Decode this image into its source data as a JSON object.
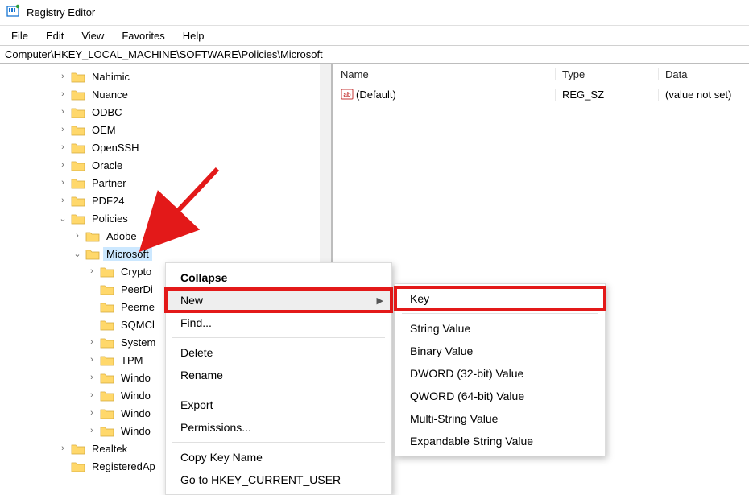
{
  "window": {
    "title": "Registry Editor"
  },
  "menu": {
    "items": [
      "File",
      "Edit",
      "View",
      "Favorites",
      "Help"
    ]
  },
  "address": {
    "path": "Computer\\HKEY_LOCAL_MACHINE\\SOFTWARE\\Policies\\Microsoft"
  },
  "tree": {
    "baseIndent": 72,
    "nodes": [
      {
        "label": "Nahimic",
        "chevron": ">",
        "indent": 72
      },
      {
        "label": "Nuance",
        "chevron": ">",
        "indent": 72
      },
      {
        "label": "ODBC",
        "chevron": ">",
        "indent": 72
      },
      {
        "label": "OEM",
        "chevron": ">",
        "indent": 72
      },
      {
        "label": "OpenSSH",
        "chevron": ">",
        "indent": 72
      },
      {
        "label": "Oracle",
        "chevron": ">",
        "indent": 72
      },
      {
        "label": "Partner",
        "chevron": ">",
        "indent": 72
      },
      {
        "label": "PDF24",
        "chevron": ">",
        "indent": 72
      },
      {
        "label": "Policies",
        "chevron": "v",
        "indent": 72
      },
      {
        "label": "Adobe",
        "chevron": ">",
        "indent": 90
      },
      {
        "label": "Microsoft",
        "chevron": "v",
        "indent": 90,
        "selected": true
      },
      {
        "label": "Crypto",
        "chevron": ">",
        "indent": 108,
        "clip": "Crypto"
      },
      {
        "label": "PeerDi",
        "chevron": "",
        "indent": 108
      },
      {
        "label": "Peerne",
        "chevron": "",
        "indent": 108
      },
      {
        "label": "SQMCl",
        "chevron": "",
        "indent": 108
      },
      {
        "label": "System",
        "chevron": ">",
        "indent": 108
      },
      {
        "label": "TPM",
        "chevron": ">",
        "indent": 108
      },
      {
        "label": "Windo",
        "chevron": ">",
        "indent": 108
      },
      {
        "label": "Windo",
        "chevron": ">",
        "indent": 108
      },
      {
        "label": "Windo",
        "chevron": ">",
        "indent": 108
      },
      {
        "label": "Windo",
        "chevron": ">",
        "indent": 108
      },
      {
        "label": "Realtek",
        "chevron": ">",
        "indent": 72
      },
      {
        "label": "RegisteredAp",
        "chevron": "",
        "indent": 72
      }
    ]
  },
  "values": {
    "headers": {
      "name": "Name",
      "type": "Type",
      "data": "Data"
    },
    "rows": [
      {
        "name": "(Default)",
        "type": "REG_SZ",
        "data": "(value not set)"
      }
    ]
  },
  "context_menu": {
    "items": [
      {
        "label": "Collapse",
        "bold": true
      },
      {
        "label": "New",
        "hover": true,
        "submenu": true,
        "highlight": true
      },
      {
        "label": "Find..."
      },
      {
        "sep": true
      },
      {
        "label": "Delete"
      },
      {
        "label": "Rename"
      },
      {
        "sep": true
      },
      {
        "label": "Export"
      },
      {
        "label": "Permissions..."
      },
      {
        "sep": true
      },
      {
        "label": "Copy Key Name"
      },
      {
        "label": "Go to HKEY_CURRENT_USER"
      }
    ]
  },
  "submenu": {
    "items": [
      {
        "label": "Key",
        "highlight": true
      },
      {
        "sep": true
      },
      {
        "label": "String Value"
      },
      {
        "label": "Binary Value"
      },
      {
        "label": "DWORD (32-bit) Value"
      },
      {
        "label": "QWORD (64-bit) Value"
      },
      {
        "label": "Multi-String Value"
      },
      {
        "label": "Expandable String Value"
      }
    ]
  }
}
